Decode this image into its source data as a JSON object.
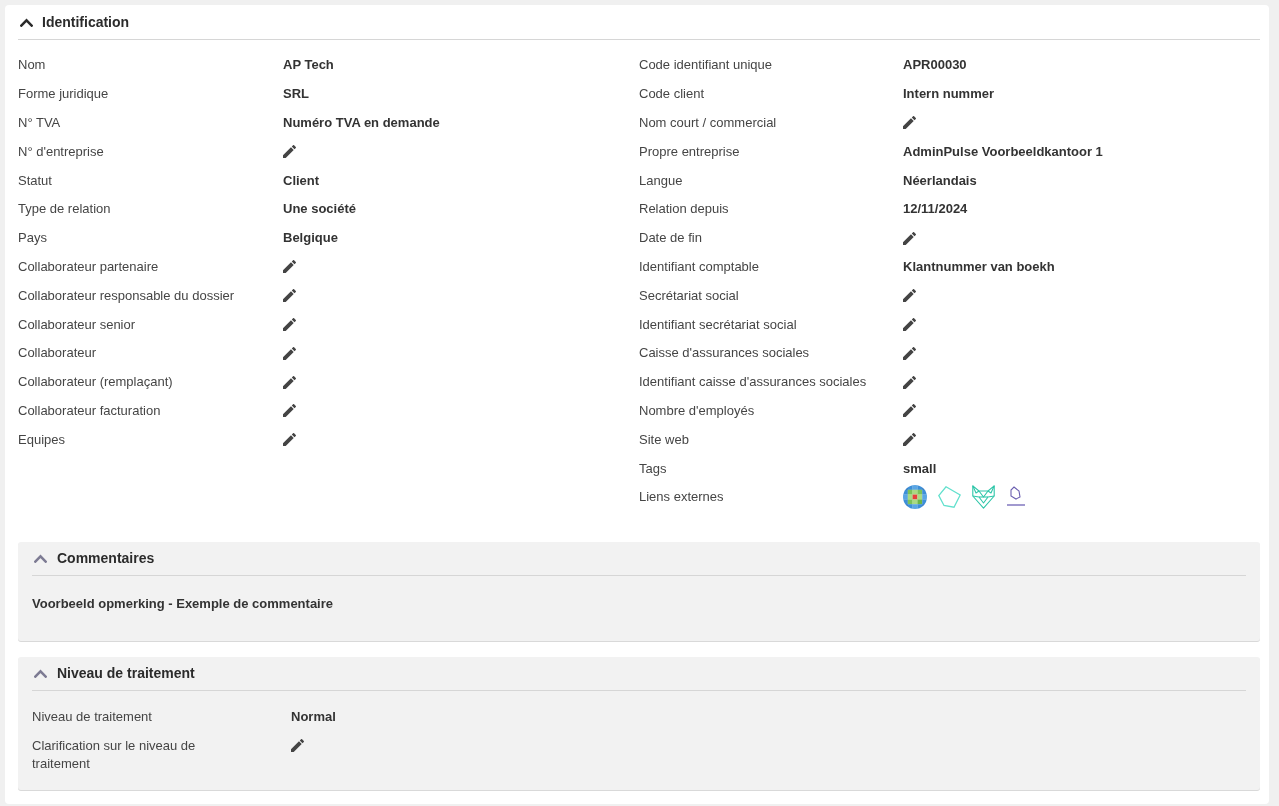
{
  "identification": {
    "title": "Identification",
    "expanded": true,
    "columns": [
      [
        {
          "label": "Nom",
          "kind": "text",
          "value": "AP Tech"
        },
        {
          "label": "Forme juridique",
          "kind": "text",
          "value": "SRL"
        },
        {
          "label": "N° TVA",
          "kind": "text",
          "value": "Numéro TVA en demande"
        },
        {
          "label": "N° d'entreprise",
          "kind": "edit"
        },
        {
          "label": "Statut",
          "kind": "text",
          "value": "Client"
        },
        {
          "label": "Type de relation",
          "kind": "text",
          "value": "Une société"
        },
        {
          "label": "Pays",
          "kind": "text",
          "value": "Belgique"
        },
        {
          "label": "Collaborateur partenaire",
          "kind": "edit"
        },
        {
          "label": "Collaborateur responsable du dossier",
          "kind": "edit"
        },
        {
          "label": "Collaborateur senior",
          "kind": "edit"
        },
        {
          "label": "Collaborateur",
          "kind": "edit"
        },
        {
          "label": "Collaborateur (remplaçant)",
          "kind": "edit"
        },
        {
          "label": "Collaborateur facturation",
          "kind": "edit"
        },
        {
          "label": "Equipes",
          "kind": "edit"
        }
      ],
      [
        {
          "label": "Code identifiant unique",
          "kind": "text",
          "value": "APR00030"
        },
        {
          "label": "Code client",
          "kind": "text",
          "value": "Intern nummer"
        },
        {
          "label": "Nom court / commercial",
          "kind": "edit"
        },
        {
          "label": "Propre entreprise",
          "kind": "text",
          "value": "AdminPulse Voorbeeldkantoor 1"
        },
        {
          "label": "Langue",
          "kind": "text",
          "value": "Néerlandais"
        },
        {
          "label": "Relation depuis",
          "kind": "text",
          "value": "12/11/2024"
        },
        {
          "label": "Date de fin",
          "kind": "edit"
        },
        {
          "label": "Identifiant comptable",
          "kind": "text",
          "value": "Klantnummer van boekh"
        },
        {
          "label": "Secrétariat social",
          "kind": "edit"
        },
        {
          "label": "Identifiant secrétariat social",
          "kind": "edit"
        },
        {
          "label": "Caisse d'assurances sociales",
          "kind": "edit"
        },
        {
          "label": "Identifiant caisse d'assurances sociales",
          "kind": "edit"
        },
        {
          "label": "Nombre d'employés",
          "kind": "edit"
        },
        {
          "label": "Site web",
          "kind": "edit"
        },
        {
          "label": "Tags",
          "kind": "text",
          "value": "small"
        },
        {
          "label": "Liens externes",
          "kind": "links"
        }
      ]
    ]
  },
  "comments": {
    "title": "Commentaires",
    "expanded": true,
    "text": "Voorbeeld opmerking - Exemple de commentaire"
  },
  "processing_level": {
    "title": "Niveau de traitement",
    "expanded": true,
    "fields": [
      {
        "label": "Niveau de traitement",
        "kind": "text",
        "value": "Normal"
      },
      {
        "label": "Clarification sur le niveau de traitement",
        "kind": "edit"
      }
    ]
  }
}
